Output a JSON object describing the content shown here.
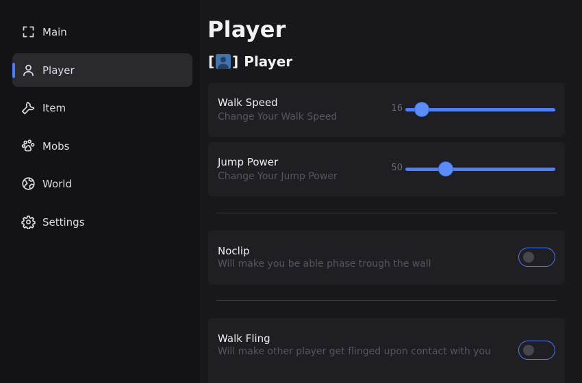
{
  "sidebar": {
    "items": [
      {
        "label": "Main",
        "icon": "fullscreen-corners-icon",
        "active": false
      },
      {
        "label": "Player",
        "icon": "user-icon",
        "active": true
      },
      {
        "label": "Item",
        "icon": "wrench-icon",
        "active": false
      },
      {
        "label": "Mobs",
        "icon": "paw-icon",
        "active": false
      },
      {
        "label": "World",
        "icon": "globe-icon",
        "active": false
      },
      {
        "label": "Settings",
        "icon": "gear-icon",
        "active": false
      }
    ]
  },
  "main": {
    "title": "Player",
    "section": {
      "bracket_open": "[",
      "bracket_close": "]",
      "label": "Player",
      "icon": "person-emoji-icon"
    },
    "walk_speed": {
      "title": "Walk Speed",
      "description": "Change Your Walk Speed",
      "value": "16",
      "fraction": 0.11
    },
    "jump_power": {
      "title": "Jump Power",
      "description": "Change Your Jump Power",
      "value": "50",
      "fraction": 0.27
    },
    "noclip": {
      "title": "Noclip",
      "description": "Will make you be able phase trough the wall",
      "enabled": false
    },
    "walk_fling": {
      "title": "Walk Fling",
      "description": "Will make other player get flinged upon contact with you",
      "enabled": false
    }
  },
  "colors": {
    "accent": "#4d7bf3",
    "background": "#18181b",
    "sidebar": "#131316",
    "card": "#1f1f23"
  }
}
